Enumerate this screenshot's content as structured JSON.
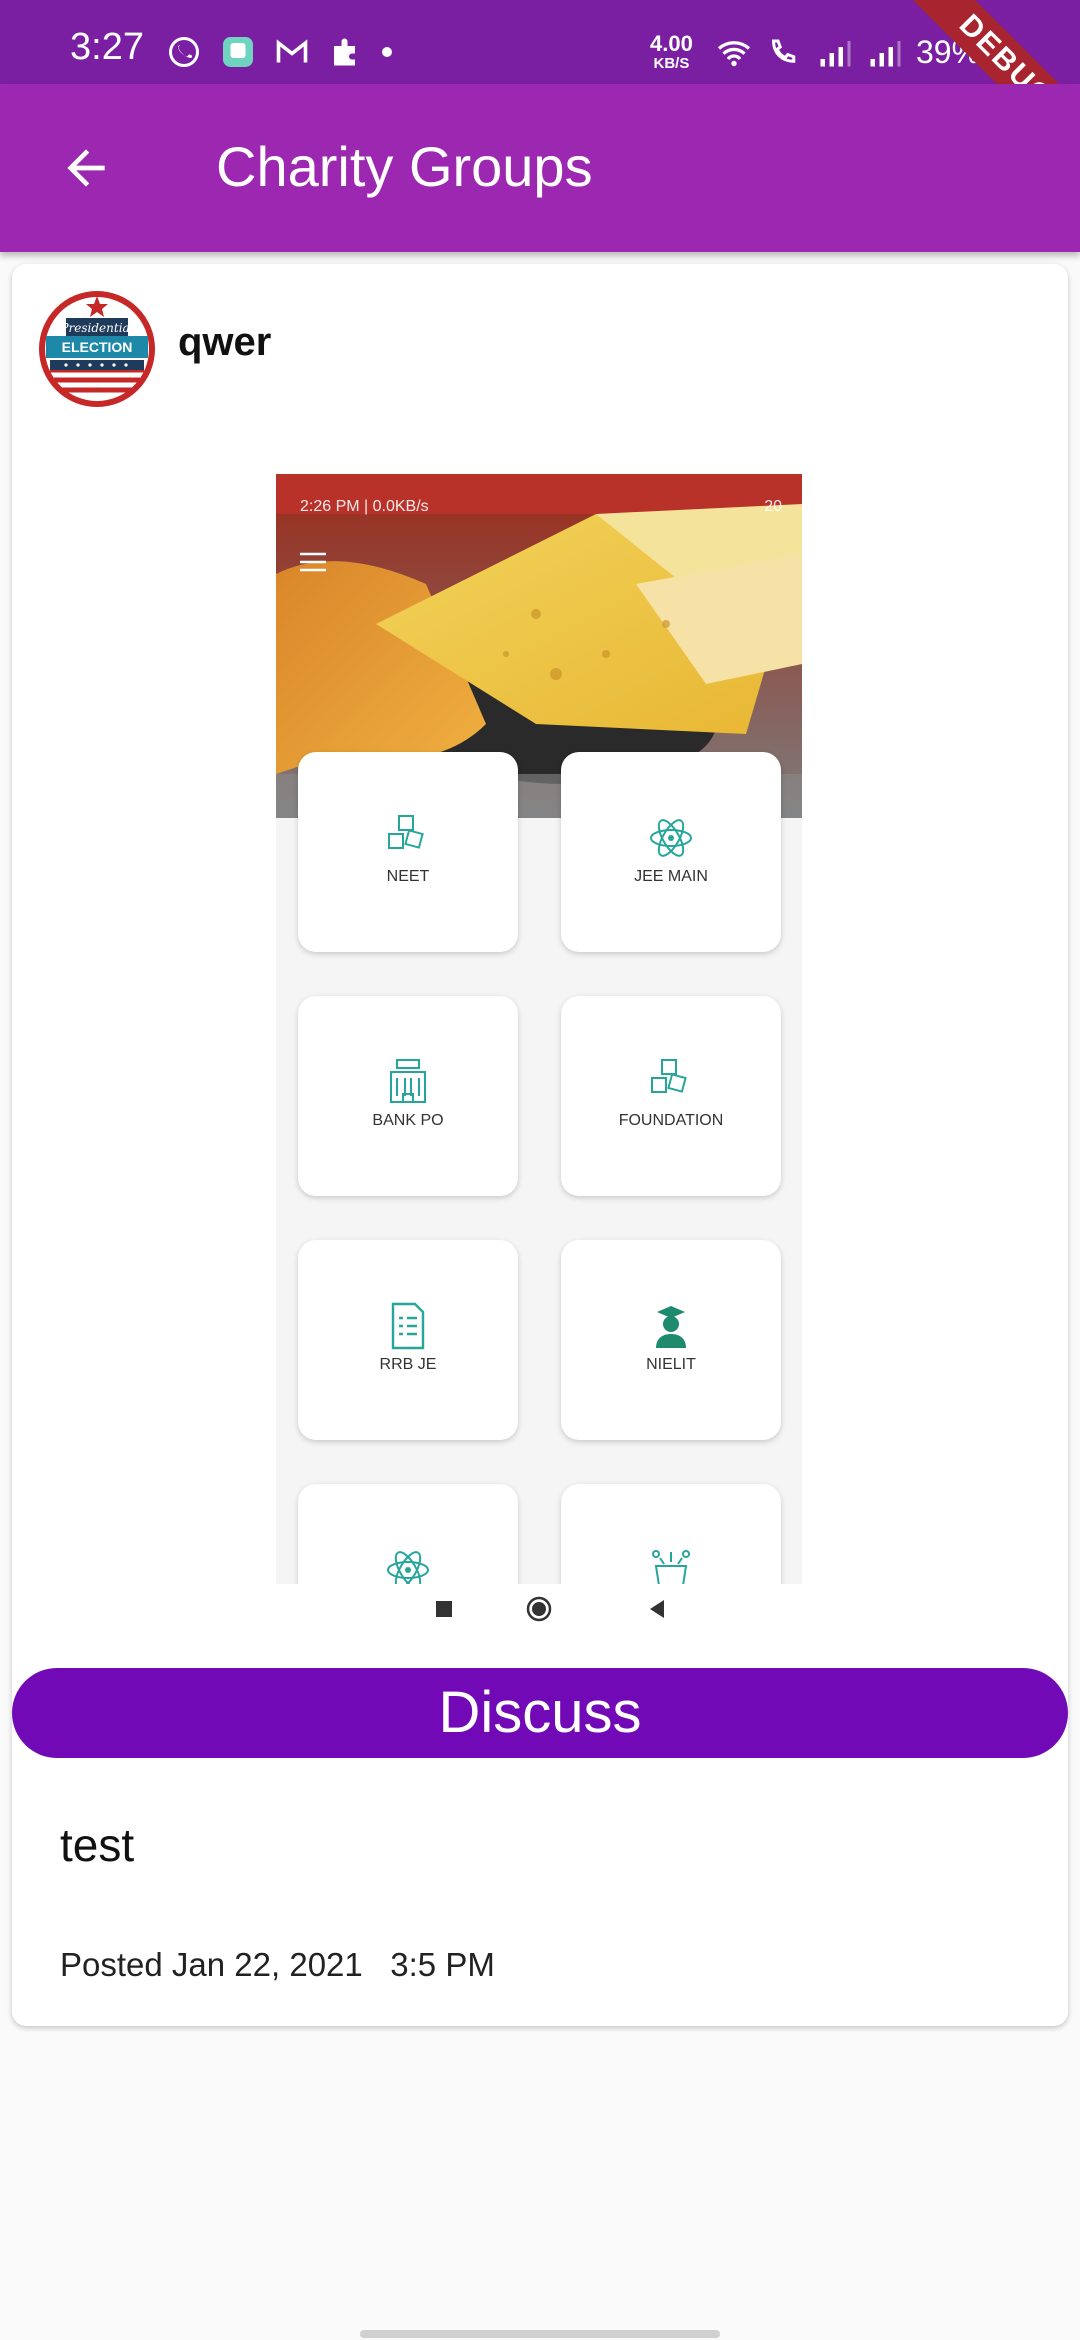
{
  "status_bar": {
    "time": "3:27",
    "net_speed": "4.00",
    "net_unit": "KB/S",
    "battery": "39%",
    "icons": [
      "whatsapp-icon",
      "app-icon",
      "gmail-icon",
      "puzzle-icon",
      "dot-icon",
      "wifi-icon",
      "wifi-call-icon",
      "signal-icon",
      "signal-icon"
    ]
  },
  "debug_banner": "DEBUG",
  "app_bar": {
    "title": "Charity Groups",
    "back_icon": "arrow-back-icon",
    "color": "#9c27b0"
  },
  "post": {
    "user_name": "qwer",
    "avatar_text_1": "Presidential",
    "avatar_text_2": "ELECTION",
    "image": {
      "status_left": "2:26 PM | 0.0KB/s",
      "status_right": "20",
      "tiles": [
        {
          "label": "NEET",
          "icon": "abc-blocks-icon"
        },
        {
          "label": "JEE MAIN",
          "icon": "atom-icon"
        },
        {
          "label": "BANK PO",
          "icon": "bank-icon"
        },
        {
          "label": "FOUNDATION",
          "icon": "abc-blocks-icon"
        },
        {
          "label": "RRB JE",
          "icon": "document-icon"
        },
        {
          "label": "NIELIT",
          "icon": "graduate-icon"
        },
        {
          "label": "",
          "icon": "atom-icon"
        },
        {
          "label": "",
          "icon": "celebration-icon"
        }
      ]
    },
    "discuss_label": "Discuss",
    "text": "test",
    "posted_label": "Posted",
    "posted_date": "Jan 22, 2021",
    "posted_time": "3:5 PM"
  },
  "colors": {
    "discuss_button": "#7209b7",
    "status_bar": "#7b1fa2",
    "tile_icon": "#26a69a"
  }
}
